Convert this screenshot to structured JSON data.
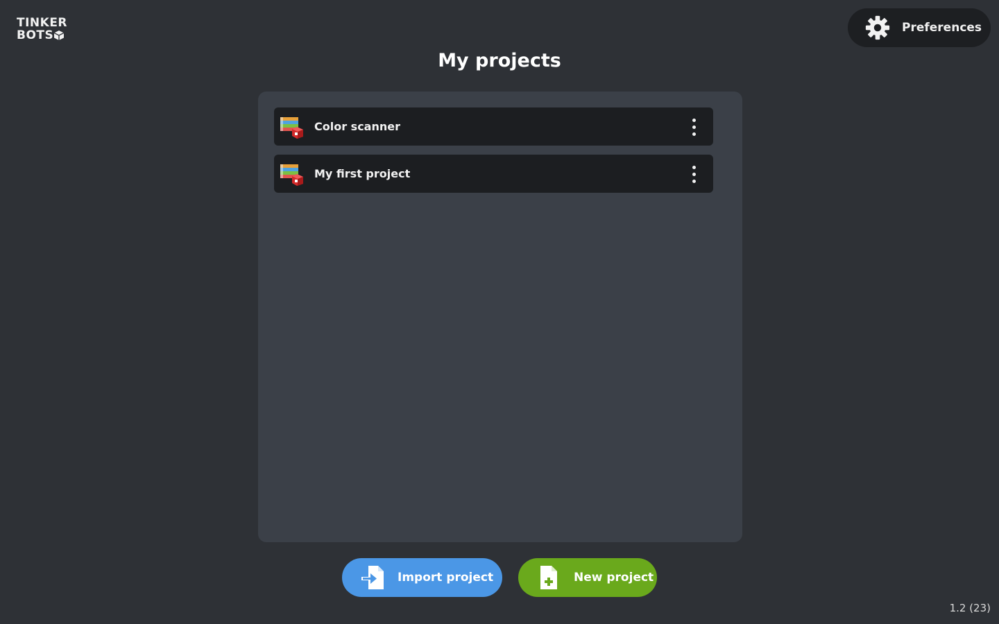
{
  "brand": {
    "logo_line1": "TINKER",
    "logo_line2": "BOTS"
  },
  "header": {
    "preferences_label": "Preferences",
    "preferences_icon": "gear-icon"
  },
  "page": {
    "title": "My projects"
  },
  "projects": [
    {
      "name": "Color scanner",
      "icon": "project-thumbnail-icon"
    },
    {
      "name": "My first project",
      "icon": "project-thumbnail-icon"
    }
  ],
  "actions": {
    "import_label": "Import project",
    "new_label": "New project"
  },
  "footer": {
    "version": "1.2 (23)"
  },
  "colors": {
    "background": "#2e3136",
    "panel": "#3b4048",
    "item": "#1c1e21",
    "import_button": "#4b97e6",
    "new_button": "#6aa91c"
  }
}
